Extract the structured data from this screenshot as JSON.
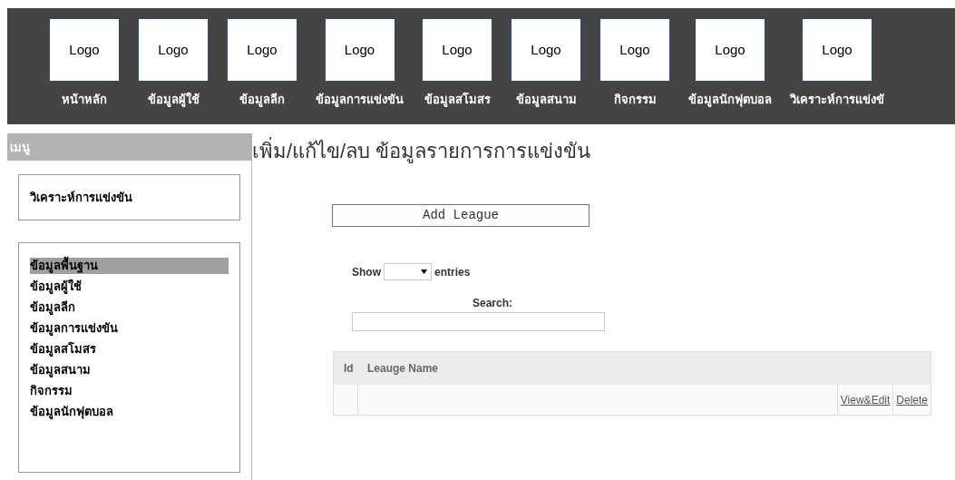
{
  "nav": [
    {
      "logo": "Logo",
      "label": "หน้าหลัก"
    },
    {
      "logo": "Logo",
      "label": "ข้อมูลผู้ใช้"
    },
    {
      "logo": "Logo",
      "label": "ข้อมูลลีก"
    },
    {
      "logo": "Logo",
      "label": "ข้อมูลการแข่งขัน"
    },
    {
      "logo": "Logo",
      "label": "ข้อมูลสโมสร"
    },
    {
      "logo": "Logo",
      "label": "ข้อมูลสนาม"
    },
    {
      "logo": "Logo",
      "label": "กิจกรรม"
    },
    {
      "logo": "Logo",
      "label": "ข้อมูลนักฟุตบอล"
    },
    {
      "logo": "Logo",
      "label": "วิเคราะห์การแข่งขั"
    }
  ],
  "sidebar": {
    "title": "เมนู",
    "analysis_link": "วิเคราะห์การแข่งขัน",
    "items": [
      {
        "label": "ข้อมูลพื้นฐาน",
        "selected": true
      },
      {
        "label": "ข้อมูลผู้ใช้",
        "selected": false
      },
      {
        "label": "ข้อมูลลีก",
        "selected": false
      },
      {
        "label": "ข้อมูลการแข่งขัน",
        "selected": false
      },
      {
        "label": "ข้อมูลสโมสร",
        "selected": false
      },
      {
        "label": "ข้อมูลสนาม",
        "selected": false
      },
      {
        "label": "กิจกรรม",
        "selected": false
      },
      {
        "label": "ข้อมูลนักฟุตบอล",
        "selected": false
      }
    ]
  },
  "main": {
    "title": "เพิ่ม/แก้ไข/ลบ ข้อมูลรายการการแข่งขัน",
    "add_button": "Add League",
    "show_label": "Show",
    "entries_label": "entries",
    "search_label": "Search:",
    "table": {
      "columns": [
        "Id",
        "Leauge Name"
      ],
      "rows": [
        {
          "actions": [
            "View&Edit",
            "Delete"
          ]
        }
      ]
    }
  }
}
